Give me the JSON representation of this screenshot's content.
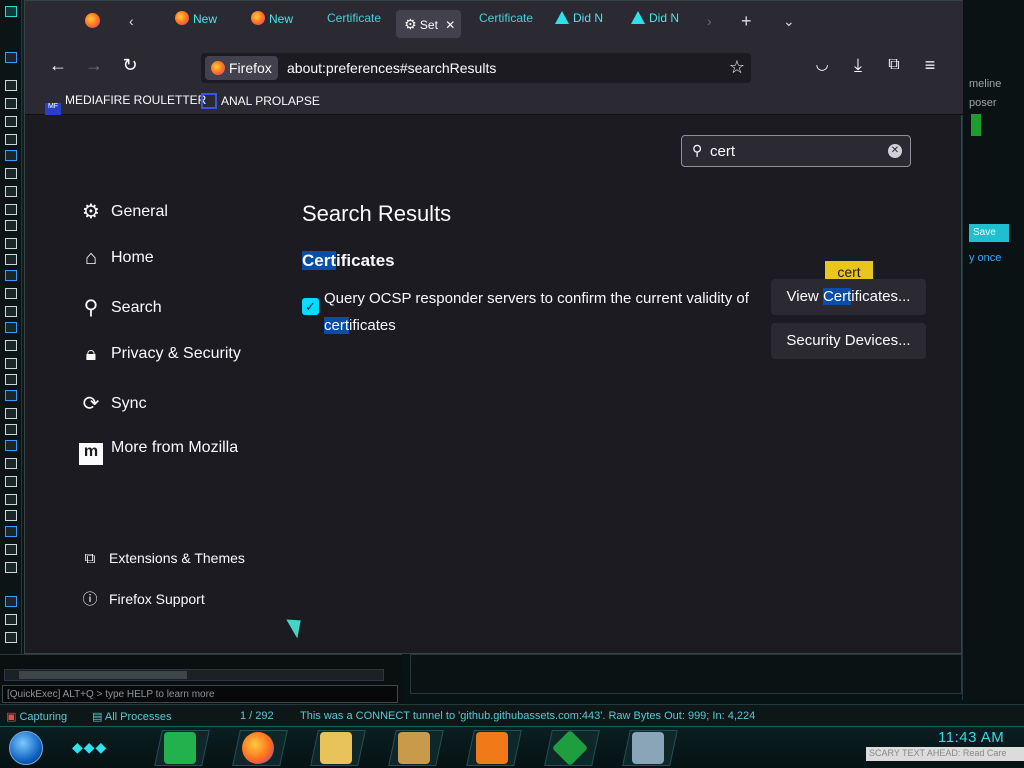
{
  "browser": {
    "tabs": [
      {
        "label": "New",
        "icon": "firefox-icon"
      },
      {
        "label": "New",
        "icon": "firefox-icon"
      },
      {
        "label": "Certificate",
        "icon": "none"
      },
      {
        "label": "Set",
        "icon": "gear-icon",
        "active": true
      },
      {
        "label": "Certificate",
        "icon": "none"
      },
      {
        "label": "Did N",
        "icon": "warning-icon"
      },
      {
        "label": "Did N",
        "icon": "warning-icon"
      }
    ],
    "identity_label": "Firefox",
    "url": "about:preferences#searchResults",
    "bookmarks": [
      {
        "label": "MEDIAFIRE ROULETTER",
        "icon": "mediafire-icon"
      },
      {
        "label": "ANAL PROLAPSE",
        "icon": "bookmark-icon"
      }
    ]
  },
  "preferences": {
    "search_value": "cert",
    "nav": [
      {
        "label": "General",
        "icon": "gear-icon"
      },
      {
        "label": "Home",
        "icon": "home-icon"
      },
      {
        "label": "Search",
        "icon": "search-icon"
      },
      {
        "label": "Privacy & Security",
        "icon": "lock-icon"
      },
      {
        "label": "Sync",
        "icon": "sync-icon"
      },
      {
        "label": "More from Mozilla",
        "icon": "mozilla-icon"
      }
    ],
    "footer_links": [
      {
        "label": "Extensions & Themes",
        "icon": "puzzle-icon"
      },
      {
        "label": "Firefox Support",
        "icon": "help-icon"
      }
    ],
    "results_title": "Search Results",
    "section": {
      "title_highlight": "Cert",
      "title_rest": "ificates",
      "checkbox_checked": true,
      "ocsp_text_before": "Query OCSP responder servers to confirm the current validity of ",
      "ocsp_highlight": "cert",
      "ocsp_text_after": "ificates"
    },
    "tooltip": "cert",
    "view_button": {
      "before": "View ",
      "highlight": "Cert",
      "after": "ificates..."
    },
    "security_button": "Security Devices..."
  },
  "background_app": {
    "right_texts": [
      "meline",
      "poser"
    ],
    "save_label": "Save",
    "once_label": "y once",
    "quickexec": "[QuickExec] ALT+Q > type HELP to learn more"
  },
  "statusbar": {
    "capturing": "Capturing",
    "processes": "All Processes",
    "count": "1 / 292",
    "message": "This was a CONNECT tunnel to 'github.githubassets.com:443'. Raw Bytes Out: 999; In: 4,224"
  },
  "taskbar": {
    "clock": "11:43 AM",
    "ticker": "SCARY TEXT AHEAD: Read Care"
  },
  "colors": {
    "accent": "#00ddff",
    "highlight": "#0a4da6",
    "tooltip": "#e8c61a",
    "teal": "#2ee3f0"
  }
}
